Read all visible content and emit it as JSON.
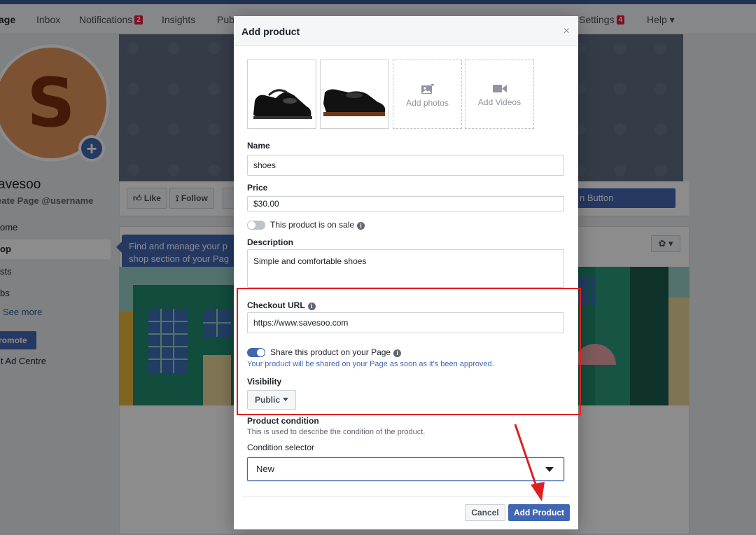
{
  "nav": {
    "items": [
      {
        "label": "age",
        "badge": ""
      },
      {
        "label": "Inbox",
        "badge": ""
      },
      {
        "label": "Notifications",
        "badge": "2"
      },
      {
        "label": "Insights",
        "badge": ""
      },
      {
        "label": "Pub",
        "badge": ""
      },
      {
        "label": "Settings",
        "badge": "4"
      },
      {
        "label": "Help ▾",
        "badge": ""
      }
    ]
  },
  "sidebar": {
    "avatar_letter": "S",
    "page_name": "avesoo",
    "username": "eate Page @username",
    "items": [
      {
        "label": "ome"
      },
      {
        "label": "op"
      },
      {
        "label": "sts"
      },
      {
        "label": "bs"
      }
    ],
    "see_more": "See more",
    "promote": "romote",
    "ad_centre": "it Ad Centre"
  },
  "page_actions": {
    "like": "Like",
    "follow": "Follow",
    "cta": "n Button"
  },
  "shop": {
    "tooltip_line1": "Find and manage your p",
    "tooltip_line2": "shop section of your Pag",
    "gear": "✿ ▾"
  },
  "modal": {
    "title": "Add product",
    "close": "×",
    "add_photos": "Add photos",
    "add_videos": "Add Videos",
    "name_label": "Name",
    "name_value": "shoes",
    "price_label": "Price",
    "price_value": "$30.00",
    "sale_label": "This product is on sale",
    "description_label": "Description",
    "description_value": "Simple and comfortable shoes",
    "checkout_label": "Checkout URL",
    "checkout_value": "https://www.savesoo.com",
    "share_label": "Share this product on your Page",
    "share_help": "Your product will be shared on your Page as soon as it's been approved.",
    "visibility_label": "Visibility",
    "visibility_value": "Public",
    "condition_label": "Product condition",
    "condition_help": "This is used to describe the condition of the product.",
    "condition_selector_label": "Condition selector",
    "condition_value": "New",
    "cancel": "Cancel",
    "add_product": "Add Product",
    "info_glyph": "i"
  },
  "colors": {
    "brand_blue": "#4267b2",
    "annotation_red": "#e02020"
  }
}
